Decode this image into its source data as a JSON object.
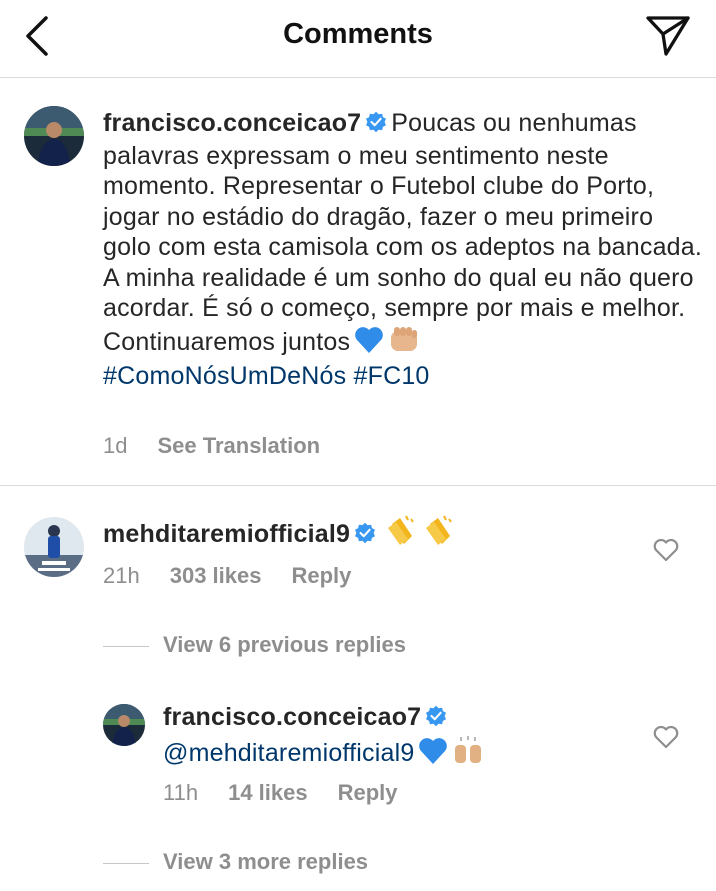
{
  "header": {
    "title": "Comments",
    "back_icon": "chevron-left-icon",
    "send_icon": "paper-plane-icon"
  },
  "caption": {
    "username": "francisco.conceicao7",
    "text": "Poucas ou nenhumas palavras expressam o meu sentimento neste momento. Representar o Futebol clube do Porto, jogar no estádio do dragão, fazer o meu primeiro golo com esta camisola com os adeptos na bancada. A minha realidade é um sonho do qual eu não quero acordar. É só o começo, sempre por mais e melhor. Continuaremos juntos",
    "hashtags": "#ComoNósUmDeNós #FC10",
    "time": "1d",
    "see_translation": "See Translation"
  },
  "comment": {
    "username": "mehditaremiofficial9",
    "time": "21h",
    "likes": "303 likes",
    "reply": "Reply"
  },
  "view_previous": "View 6 previous replies",
  "reply": {
    "username": "francisco.conceicao7",
    "mention": "@mehditaremiofficial9",
    "time": "11h",
    "likes": "14 likes",
    "reply": "Reply"
  },
  "view_more": "View 3 more replies",
  "colors": {
    "text": "#262626",
    "muted": "#8e8e8e",
    "link": "#00376b",
    "verified": "#3897f0",
    "divider": "#dbdbdb"
  }
}
